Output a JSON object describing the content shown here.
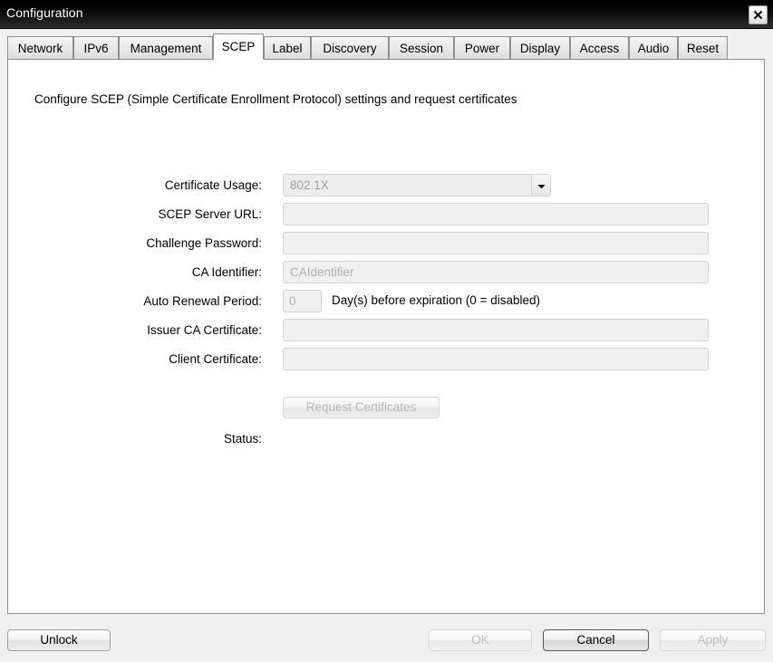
{
  "window": {
    "title": "Configuration",
    "close_icon": "close-icon",
    "close_glyph": "×"
  },
  "tabs": [
    {
      "label": "Network",
      "active": false
    },
    {
      "label": "IPv6",
      "active": false
    },
    {
      "label": "Management",
      "active": false
    },
    {
      "label": "SCEP",
      "active": true
    },
    {
      "label": "Label",
      "active": false
    },
    {
      "label": "Discovery",
      "active": false
    },
    {
      "label": "Session",
      "active": false
    },
    {
      "label": "Power",
      "active": false
    },
    {
      "label": "Display",
      "active": false
    },
    {
      "label": "Access",
      "active": false
    },
    {
      "label": "Audio",
      "active": false
    },
    {
      "label": "Reset",
      "active": false
    }
  ],
  "panel": {
    "description": "Configure SCEP (Simple Certificate Enrollment Protocol) settings and request certificates",
    "fields": {
      "certificate_usage": {
        "label": "Certificate Usage:",
        "value": "802.1X",
        "arrow_icon": "chevron-down-icon"
      },
      "scep_server_url": {
        "label": "SCEP Server URL:",
        "value": "",
        "placeholder": ""
      },
      "challenge_password": {
        "label": "Challenge Password:",
        "value": "",
        "placeholder": ""
      },
      "ca_identifier": {
        "label": "CA Identifier:",
        "value": "",
        "placeholder": "CAIdentifier"
      },
      "auto_renewal_period": {
        "label": "Auto Renewal Period:",
        "value": "0",
        "note": "Day(s) before expiration (0 = disabled)"
      },
      "issuer_ca_certificate": {
        "label": "Issuer CA Certificate:",
        "value": "",
        "placeholder": ""
      },
      "client_certificate": {
        "label": "Client Certificate:",
        "value": "",
        "placeholder": ""
      }
    },
    "request_certificates_button": "Request Certificates",
    "status": {
      "label": "Status:",
      "value": ""
    }
  },
  "buttonbar": {
    "unlock": "Unlock",
    "ok": "OK",
    "cancel": "Cancel",
    "apply": "Apply"
  },
  "colors": {
    "titlebar": "#000000",
    "panel_background": "#ffffff",
    "window_background": "#f0f0f0",
    "field_background": "#f0f0f0",
    "disabled_text": "#b0b0b0"
  }
}
